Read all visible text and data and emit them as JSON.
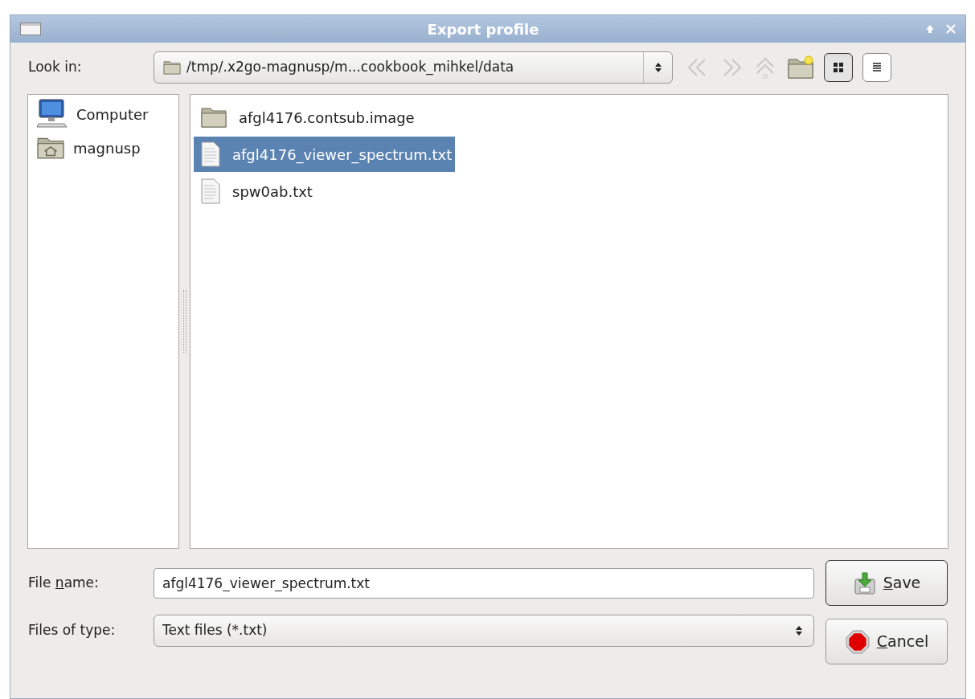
{
  "window": {
    "title": "Export profile",
    "title_buttons": [
      {
        "kind": "shade"
      },
      {
        "kind": "close"
      }
    ]
  },
  "look_in": {
    "label": "Look in:",
    "path": "/tmp/.x2go-magnusp/m...cookbook_mihkel/data"
  },
  "toolbar": [
    {
      "kind": "back",
      "disabled": true
    },
    {
      "kind": "forward",
      "disabled": true
    },
    {
      "kind": "up",
      "disabled": true
    },
    {
      "kind": "new-folder",
      "disabled": false
    },
    {
      "kind": "icon-view",
      "selected": true
    },
    {
      "kind": "list-view",
      "selected": false
    }
  ],
  "sidebar": {
    "items": [
      {
        "kind": "computer",
        "label": "Computer"
      },
      {
        "kind": "home",
        "label": "magnusp"
      }
    ]
  },
  "files": [
    {
      "kind": "folder",
      "name": "afgl4176.contsub.image",
      "selected": false
    },
    {
      "kind": "file",
      "name": "afgl4176_viewer_spectrum.txt",
      "selected": true
    },
    {
      "kind": "file",
      "name": "spw0ab.txt",
      "selected": false
    }
  ],
  "file_name": {
    "label": {
      "before": "File ",
      "key": "n",
      "after": "ame:"
    },
    "value": "afgl4176_viewer_spectrum.txt"
  },
  "file_type": {
    "label": "Files of type:",
    "value": "Text files (*.txt)"
  },
  "buttons": [
    {
      "kind": "save",
      "label": {
        "key": "S",
        "after": "ave"
      }
    },
    {
      "kind": "cancel",
      "label": {
        "key": "C",
        "after": "ancel"
      }
    }
  ]
}
